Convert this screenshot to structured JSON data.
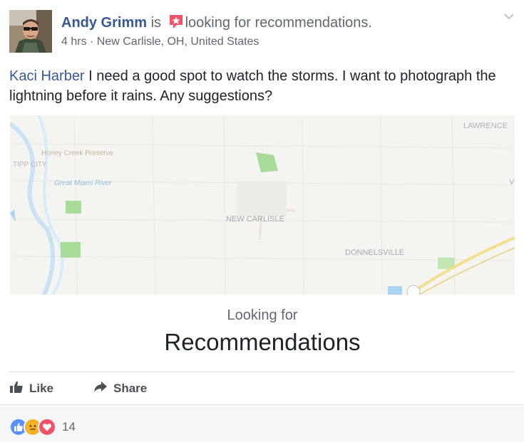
{
  "post": {
    "author": "Andy Grimm",
    "is_word": "is",
    "activity": "looking for recommendations.",
    "activity_icon": "recommendation-star-icon",
    "time": "4 hrs",
    "meta_separator": " · ",
    "location": "New Carlisle, OH, United States",
    "text_mention": "Kaci Harber",
    "text_body": "I need a good spot to watch the storms. I want to photograph the lightning before it rains. Any suggestions?"
  },
  "map": {
    "labels": {
      "lawrenceville": "LAWRENCE",
      "tipp_city": "TIPP CITY",
      "honey_creek": "Honey Creek Preserve",
      "river": "Great Miami River",
      "new_carlisle": "NEW CARLISLE",
      "donnelsville": "DONNELSVILLE",
      "v_fragment": "V"
    },
    "colors": {
      "land": "#f4f4f1",
      "park": "#a8dc9a",
      "water": "#a9d3f2",
      "highway": "#f2e08a"
    }
  },
  "recommendation": {
    "subtitle": "Looking for",
    "title": "Recommendations"
  },
  "actions": {
    "like_label": "Like",
    "like_icon": "thumbs-up-icon",
    "share_label": "Share",
    "share_icon": "share-arrow-icon"
  },
  "reactions": {
    "icons": [
      "like-reaction-icon",
      "sad-reaction-icon",
      "love-reaction-icon"
    ],
    "count": "14",
    "colors": {
      "like": "#5890ff",
      "sad": "#f7b125",
      "love": "#f25268"
    }
  },
  "colors": {
    "link": "#365899",
    "secondary": "#606770",
    "accent_star": "#f35369"
  }
}
